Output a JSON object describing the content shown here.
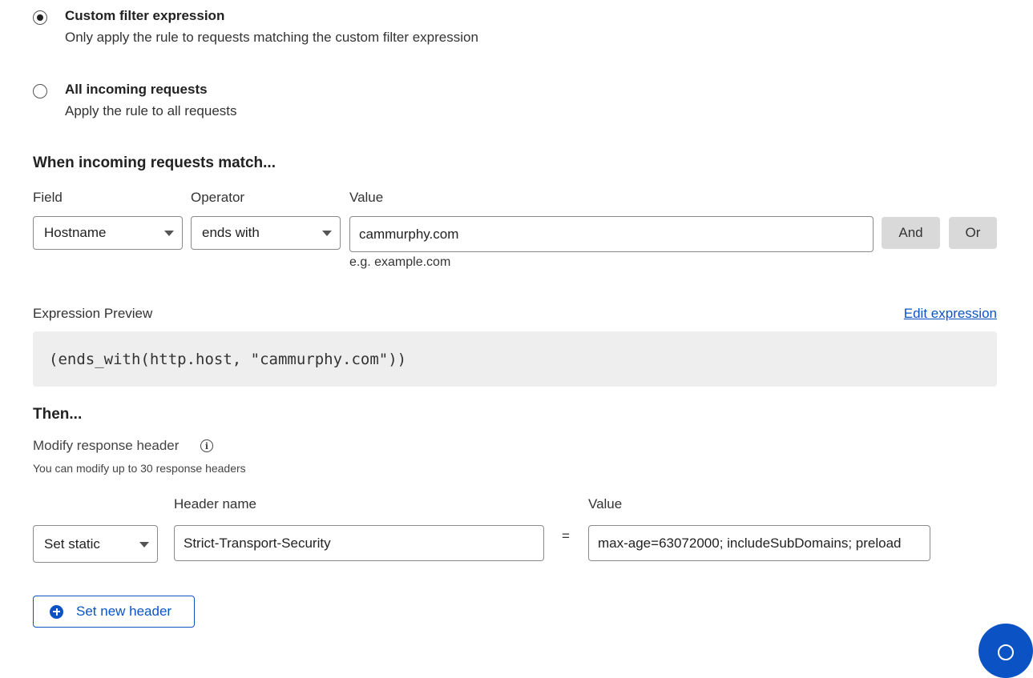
{
  "filter_options": [
    {
      "title": "Custom filter expression",
      "description": "Only apply the rule to requests matching the custom filter expression",
      "selected": true
    },
    {
      "title": "All incoming requests",
      "description": "Apply the rule to all requests",
      "selected": false
    }
  ],
  "match": {
    "heading": "When incoming requests match...",
    "field_label": "Field",
    "operator_label": "Operator",
    "value_label": "Value",
    "field_value": "Hostname",
    "operator_value": "ends with",
    "value_value": "cammurphy.com",
    "value_hint": "e.g. example.com",
    "and_label": "And",
    "or_label": "Or"
  },
  "preview": {
    "label": "Expression Preview",
    "edit_link": "Edit expression",
    "expression": "(ends_with(http.host, \"cammurphy.com\"))"
  },
  "then": {
    "heading": "Then...",
    "action_label": "Modify response header",
    "info_icon": "info-icon",
    "limit_note": "You can modify up to 30 response headers",
    "header_name_label": "Header name",
    "value_label": "Value",
    "operation_value": "Set static",
    "header_name_value": "Strict-Transport-Security",
    "equals": "=",
    "header_value": "max-age=63072000; includeSubDomains; preload",
    "add_button": "Set new header"
  },
  "colors": {
    "accent": "#0b53c4",
    "code_bg": "#eeeeee",
    "gray_button": "#d9d9d9"
  }
}
